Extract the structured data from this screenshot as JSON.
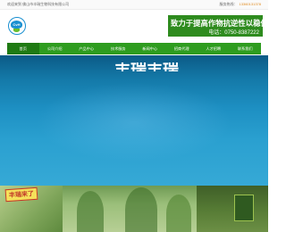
{
  "topbar": {
    "welcome": "欢迎来到 佛山市丰瑞生物科技有限公司",
    "hotline_label": "服务热线：",
    "hotline_number": "13360131378"
  },
  "header": {
    "logo_text": "CvH",
    "slogan": "致力于提高作物抗逆性以稳保丰收",
    "phone": "电话：0750-8387222"
  },
  "nav": {
    "items": [
      {
        "label": "首页",
        "active": true
      },
      {
        "label": "公司介绍",
        "active": false
      },
      {
        "label": "产品中心",
        "active": false
      },
      {
        "label": "技术服务",
        "active": false
      },
      {
        "label": "新闻中心",
        "active": false
      },
      {
        "label": "招商代理",
        "active": false
      },
      {
        "label": "人才招聘",
        "active": false
      },
      {
        "label": "联系我们",
        "active": false
      }
    ]
  },
  "banner": {
    "slogan": "丰瑞丰瑞"
  },
  "banner2": {
    "caption": "丰瑞来了"
  },
  "colors": {
    "nav_green": "#2e9c1f",
    "nav_active": "#1f7a13",
    "slogan_bg": "#2e8b1e",
    "banner_blue": "#1d8fc2",
    "hotline_orange": "#e08a1e"
  }
}
